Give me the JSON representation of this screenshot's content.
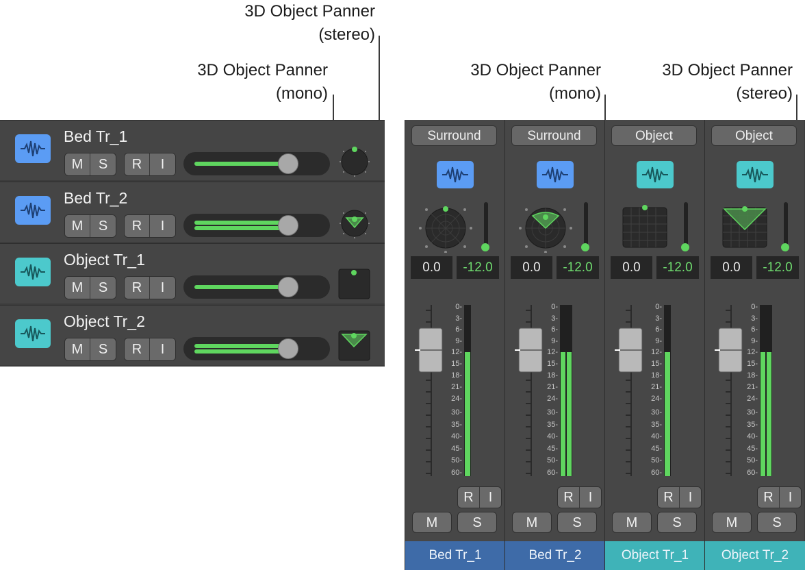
{
  "callouts": {
    "stereo_top_title": "3D Object Panner",
    "stereo_top_sub": "(stereo)",
    "mono_left_title": "3D Object Panner",
    "mono_left_sub": "(mono)",
    "mono_right_title": "3D Object Panner",
    "mono_right_sub": "(mono)",
    "stereo_right_title": "3D Object Panner",
    "stereo_right_sub": "(stereo)"
  },
  "colors": {
    "bed": "#5b9cf4",
    "object": "#4cc9cc",
    "green": "#5fd65f",
    "bed_name_bar": "#3e6ba8",
    "object_name_bar": "#3fb3b8"
  },
  "track_list": {
    "tracks": [
      {
        "name": "Bed Tr_1",
        "type": "bed",
        "panner": "surround-knob",
        "buttons": [
          "M",
          "S",
          "R",
          "I"
        ],
        "volume_fraction": 0.7,
        "icon": "waveform-icon"
      },
      {
        "name": "Bed Tr_2",
        "type": "bed",
        "panner": "surround-knob-stereo",
        "buttons": [
          "M",
          "S",
          "R",
          "I"
        ],
        "volume_fraction": 0.7,
        "icon": "waveform-icon"
      },
      {
        "name": "Object Tr_1",
        "type": "object",
        "panner": "object-mono",
        "buttons": [
          "M",
          "S",
          "R",
          "I"
        ],
        "volume_fraction": 0.7,
        "icon": "waveform-icon"
      },
      {
        "name": "Object Tr_2",
        "type": "object",
        "panner": "object-stereo",
        "buttons": [
          "M",
          "S",
          "R",
          "I"
        ],
        "volume_fraction": 0.7,
        "icon": "waveform-icon"
      }
    ]
  },
  "mixer": {
    "scale_labels": [
      "0",
      "3",
      "6",
      "9",
      "12",
      "15",
      "18",
      "21",
      "24",
      "30",
      "35",
      "40",
      "45",
      "50",
      "60"
    ],
    "strips": [
      {
        "mode": "Surround",
        "type": "bed",
        "pan": "0.0",
        "volume": "-12.0",
        "record": "R",
        "input": "I",
        "mute": "M",
        "solo": "S",
        "name": "Bed Tr_1",
        "meter_fraction": 0.7
      },
      {
        "mode": "Surround",
        "type": "bed",
        "pan": "0.0",
        "volume": "-12.0",
        "record": "R",
        "input": "I",
        "mute": "M",
        "solo": "S",
        "name": "Bed Tr_2",
        "meter_fraction": 0.7
      },
      {
        "mode": "Object",
        "type": "object",
        "pan": "0.0",
        "volume": "-12.0",
        "record": "R",
        "input": "I",
        "mute": "M",
        "solo": "S",
        "name": "Object Tr_1",
        "meter_fraction": 0.7
      },
      {
        "mode": "Object",
        "type": "object",
        "pan": "0.0",
        "volume": "-12.0",
        "record": "R",
        "input": "I",
        "mute": "M",
        "solo": "S",
        "name": "Object Tr_2",
        "meter_fraction": 0.7
      }
    ]
  }
}
